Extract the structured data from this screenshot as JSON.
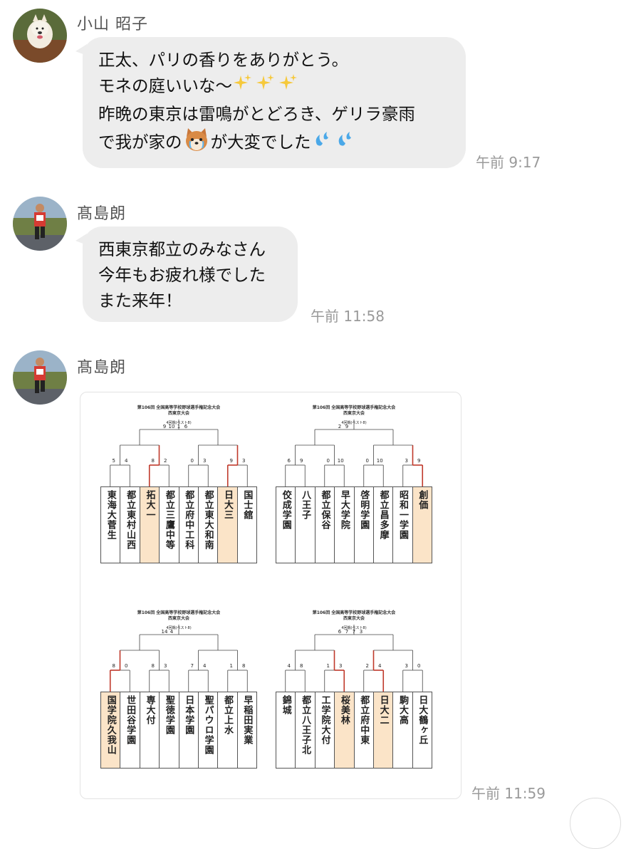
{
  "messages": [
    {
      "sender": "小山 昭子",
      "lines": [
        "正太、パリの香りをありがとう。",
        "モネの庭いいな〜",
        "昨晩の東京は雷鳴がとどろき、ゲリラ豪雨",
        "で我が家の",
        "が大変でした"
      ],
      "time": "午前 9:17"
    },
    {
      "sender": "髙島朗",
      "lines": [
        "西東京都立のみなさん",
        "今年もお疲れ様でした",
        "また来年！"
      ],
      "time": "午前 11:58"
    },
    {
      "sender": "髙島朗",
      "time": "午前 11:59",
      "image": {
        "panels": [
          {
            "title": [
              "第106回 全国高等学校野球選手権記念大会",
              "西東京大会"
            ],
            "round_label": "4回戦(ベスト8)",
            "teams": [
              "東海大菅生",
              "都立東村山西",
              "拓大一",
              "都立三鷹中等",
              "都立府中工科",
              "都立東大和南",
              "日大三",
              "国士舘"
            ],
            "winners": [
              2,
              6
            ],
            "scores_top": [
              "9",
              "10",
              "1",
              "6"
            ],
            "scores_mid": [
              "5",
              "4",
              "8",
              "2",
              "0",
              "3",
              "9",
              "3"
            ]
          },
          {
            "title": [
              "第106回 全国高等学校野球選手権記念大会",
              "西東京大会"
            ],
            "round_label": "4回戦(ベスト8)",
            "teams": [
              "佼成学園",
              "八王子",
              "都立保谷",
              "早大学院",
              "啓明学園",
              "都立昌多摩",
              "昭和一学園",
              "創価"
            ],
            "winners": [
              7
            ],
            "scores_top": [
              "2",
              "9"
            ],
            "scores_mid": [
              "6",
              "9",
              "0",
              "10",
              "0",
              "10",
              "3",
              "9"
            ]
          },
          {
            "title": [
              "第106回 全国高等学校野球選手権記念大会",
              "西東京大会"
            ],
            "round_label": "4回戦(ベスト8)",
            "teams": [
              "国学院久我山",
              "世田谷学園",
              "専大付",
              "聖徳学園",
              "日本学園",
              "聖パウロ学園",
              "都立上水",
              "早稲田実業"
            ],
            "winners": [
              0
            ],
            "scores_top": [
              "14",
              "4"
            ],
            "scores_mid": [
              "8",
              "0",
              "8",
              "3",
              "7",
              "4",
              "1",
              "8"
            ]
          },
          {
            "title": [
              "第106回 全国高等学校野球選手権記念大会",
              "西東京大会"
            ],
            "round_label": "4回戦(ベスト8)",
            "teams": [
              "錦城",
              "都立八王子北",
              "工学院大付",
              "桜美林",
              "都立府中東",
              "日大二",
              "駒大高",
              "日大鶴ヶ丘"
            ],
            "winners": [
              3,
              5
            ],
            "scores_top": [
              "6",
              "7",
              "7",
              "3"
            ],
            "scores_mid": [
              "4",
              "8",
              "1",
              "3",
              "2",
              "4",
              "3",
              "0"
            ]
          }
        ]
      }
    }
  ]
}
